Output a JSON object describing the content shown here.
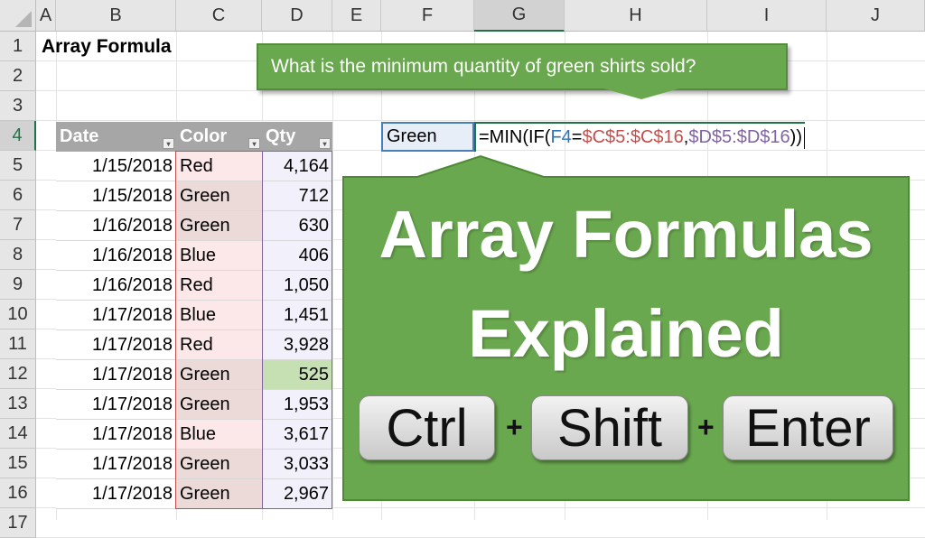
{
  "columns": [
    "A",
    "B",
    "C",
    "D",
    "E",
    "F",
    "G",
    "H",
    "I",
    "J"
  ],
  "rows": [
    "1",
    "2",
    "3",
    "4",
    "5",
    "6",
    "7",
    "8",
    "9",
    "10",
    "11",
    "12",
    "13",
    "14",
    "15",
    "16",
    "17"
  ],
  "title": "Array Formula",
  "question": "What is the minimum quantity of green shirts sold?",
  "table": {
    "headers": [
      "Date",
      "Color",
      "Qty"
    ],
    "rows": [
      {
        "date": "1/15/2018",
        "color": "Red",
        "qty": "4,164"
      },
      {
        "date": "1/15/2018",
        "color": "Green",
        "qty": "712"
      },
      {
        "date": "1/16/2018",
        "color": "Green",
        "qty": "630"
      },
      {
        "date": "1/16/2018",
        "color": "Blue",
        "qty": "406"
      },
      {
        "date": "1/16/2018",
        "color": "Red",
        "qty": "1,050"
      },
      {
        "date": "1/17/2018",
        "color": "Blue",
        "qty": "1,451"
      },
      {
        "date": "1/17/2018",
        "color": "Red",
        "qty": "3,928"
      },
      {
        "date": "1/17/2018",
        "color": "Green",
        "qty": "525"
      },
      {
        "date": "1/17/2018",
        "color": "Green",
        "qty": "1,953"
      },
      {
        "date": "1/17/2018",
        "color": "Blue",
        "qty": "3,617"
      },
      {
        "date": "1/17/2018",
        "color": "Green",
        "qty": "3,033"
      },
      {
        "date": "1/17/2018",
        "color": "Green",
        "qty": "2,967"
      }
    ]
  },
  "criteria_cell": "Green",
  "formula": {
    "p1": "=MIN(IF(",
    "p2": "F4",
    "p3": "=",
    "p4": "$C$5:$C$16",
    "p5": ",",
    "p6": "$D$5:$D$16",
    "p7": "))"
  },
  "banner": {
    "line1": "Array Formulas",
    "line2": "Explained"
  },
  "keys": [
    "Ctrl",
    "Shift",
    "Enter"
  ],
  "plus": "+",
  "colors": {
    "green": "#6aa84f",
    "header_gray": "#a6a6a6",
    "highlight": "#c6e0b4"
  }
}
